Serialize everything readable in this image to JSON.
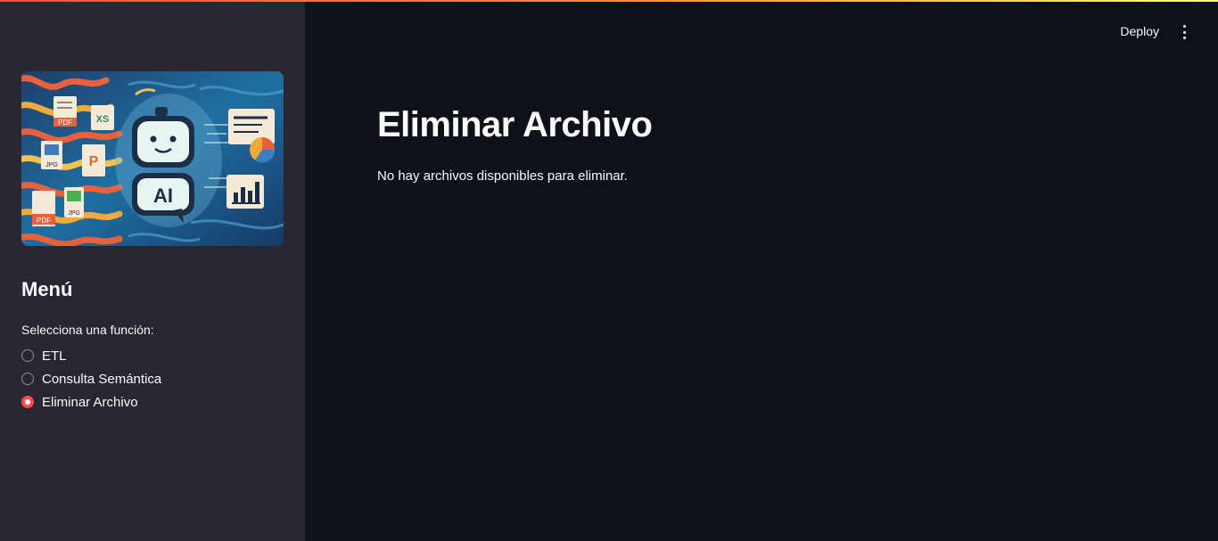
{
  "app": {
    "accent": "#ff4b4b",
    "sidebar_bg": "#262730",
    "main_bg": "#0e1117"
  },
  "header": {
    "deploy_label": "Deploy",
    "menu_icon": "vertical-dots-icon"
  },
  "sidebar": {
    "hero_image": {
      "icons": [
        "robot-icon",
        "pdf-file-icon",
        "xls-file-icon",
        "jpg-file-icon",
        "ppt-file-icon",
        "document-chart-icon",
        "bar-chart-icon"
      ],
      "labels": {
        "ai": "AI",
        "pdf": "PDF",
        "xls": "XS",
        "jpg": "JPG",
        "ppt": "P"
      }
    },
    "title": "Menú",
    "radio": {
      "label": "Selecciona una función:",
      "options": [
        {
          "label": "ETL",
          "selected": false
        },
        {
          "label": "Consulta Semántica",
          "selected": false
        },
        {
          "label": "Eliminar Archivo",
          "selected": true
        }
      ]
    }
  },
  "main": {
    "title": "Eliminar Archivo",
    "message": "No hay archivos disponibles para eliminar."
  }
}
